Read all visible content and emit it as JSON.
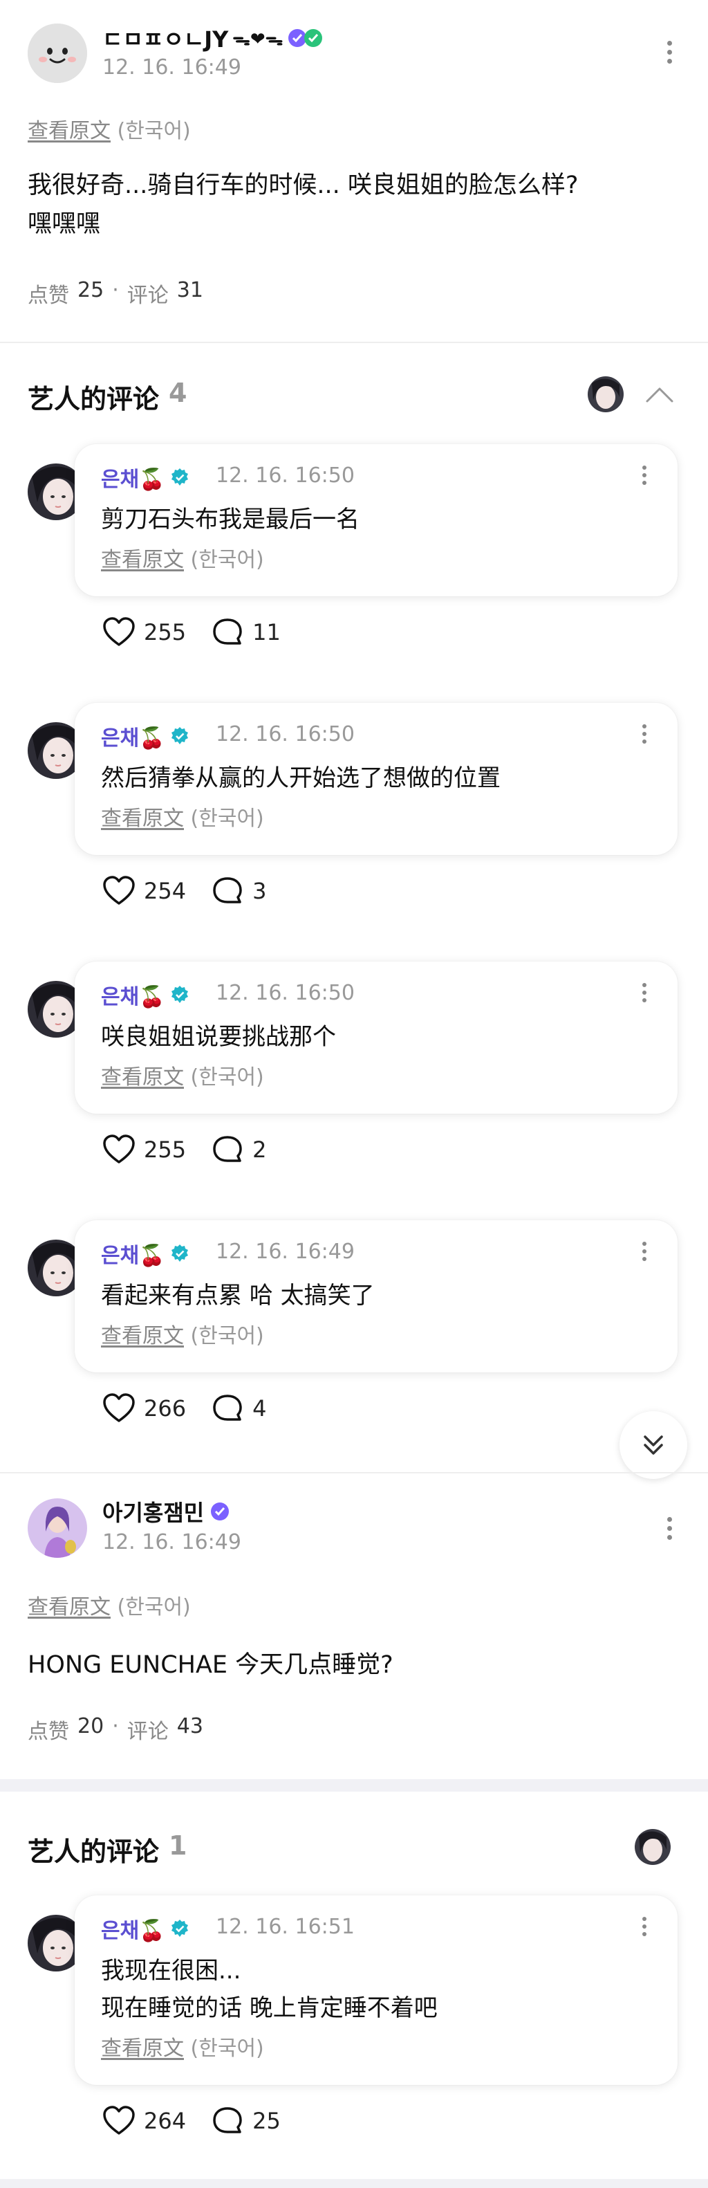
{
  "post1": {
    "username": "ㄷㅁㅍㅇㄴJY",
    "username_suffix": "ᯓ❤︎ᯓ",
    "time": "12. 16. 16:49",
    "view_original": "查看原文",
    "lang_tag": "(한국어)",
    "text_line1": "我很好奇...骑自行车的时候... 咲良姐姐的脸怎么样?",
    "text_line2": "嘿嘿嘿",
    "likes_label": "点赞",
    "likes": "25",
    "sep": "·",
    "comments_label": "评论",
    "comments": "31"
  },
  "artist_section1": {
    "title": "艺人的评论",
    "count": "4"
  },
  "replies1": [
    {
      "name": "은채🍒",
      "time": "12. 16. 16:50",
      "lines": [
        "剪刀石头布我是最后一名"
      ],
      "view_original": "查看原文",
      "lang_tag": "(한국어)",
      "likes": "255",
      "comments": "11"
    },
    {
      "name": "은채🍒",
      "time": "12. 16. 16:50",
      "lines": [
        "然后猜拳从赢的人开始选了想做的位置"
      ],
      "view_original": "查看原文",
      "lang_tag": "(한국어)",
      "likes": "254",
      "comments": "3"
    },
    {
      "name": "은채🍒",
      "time": "12. 16. 16:50",
      "lines": [
        "咲良姐姐说要挑战那个"
      ],
      "view_original": "查看原文",
      "lang_tag": "(한국어)",
      "likes": "255",
      "comments": "2"
    },
    {
      "name": "은채🍒",
      "time": "12. 16. 16:49",
      "lines": [
        "看起来有点累 哈 太搞笑了"
      ],
      "view_original": "查看原文",
      "lang_tag": "(한국어)",
      "likes": "266",
      "comments": "4"
    }
  ],
  "post2": {
    "username": "아기홍잼민",
    "time": "12. 16. 16:49",
    "view_original": "查看原文",
    "lang_tag": "(한국어)",
    "text": "HONG EUNCHAE 今天几点睡觉?",
    "likes_label": "点赞",
    "likes": "20",
    "sep": "·",
    "comments_label": "评论",
    "comments": "43"
  },
  "artist_section2": {
    "title": "艺人的评论",
    "count": "1"
  },
  "replies2": [
    {
      "name": "은채🍒",
      "time": "12. 16. 16:51",
      "lines": [
        "我现在很困...",
        "现在睡觉的话 晚上肯定睡不着吧"
      ],
      "view_original": "查看原文",
      "lang_tag": "(한국어)",
      "likes": "264",
      "comments": "25"
    }
  ],
  "colors": {
    "artist_name": "#5b4fd1",
    "verified_teal": "#1fb5c9",
    "verified_purple": "#7b61ff",
    "gray_text": "#999999"
  },
  "icons": [
    "more-vertical-icon",
    "chevron-up-icon",
    "heart-icon",
    "comment-bubble-icon",
    "verified-badge-icon",
    "scroll-down-double-chevron-icon"
  ]
}
